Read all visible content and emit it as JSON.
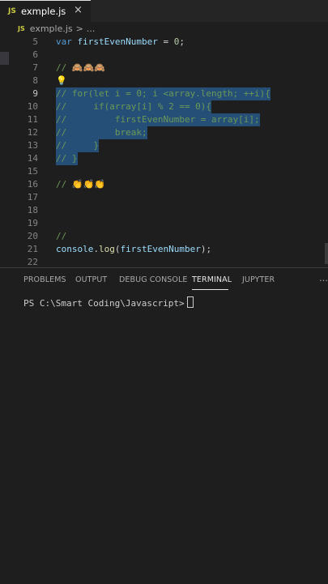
{
  "tab": {
    "filename": "exmple.js",
    "lang_badge": "JS",
    "close": "×"
  },
  "breadcrumb": {
    "lang_badge": "JS",
    "file": "exmple.js",
    "separator": ">",
    "more": "..."
  },
  "editor": {
    "lines": [
      {
        "n": "5",
        "a": "var ",
        "b": "firstEvenNumber",
        "c": " = ",
        "d": "0",
        "e": ";"
      },
      {
        "n": "6"
      },
      {
        "n": "7",
        "comment": "// ",
        "emoji": "🙈🙈🙈"
      },
      {
        "n": "8",
        "bulb": "💡"
      },
      {
        "n": "9",
        "text": "// for(let i = 0; i <array.length; ++i){"
      },
      {
        "n": "10",
        "text": "//     if(array[i] % 2 == 0){"
      },
      {
        "n": "11",
        "text": "//         firstEvenNumber = array[i];"
      },
      {
        "n": "12",
        "text": "//         break;"
      },
      {
        "n": "13",
        "text": "//     }"
      },
      {
        "n": "14",
        "text": "// }"
      },
      {
        "n": "15"
      },
      {
        "n": "16",
        "comment": "// ",
        "emoji": "👏👏👏"
      },
      {
        "n": "17"
      },
      {
        "n": "18"
      },
      {
        "n": "19"
      },
      {
        "n": "20",
        "comment": "//"
      },
      {
        "n": "21",
        "obj": "console",
        "dot": ".",
        "fn": "log",
        "open": "(",
        "arg": "firstEvenNumber",
        "close": ");"
      },
      {
        "n": "22"
      }
    ]
  },
  "panel": {
    "tabs": [
      "PROBLEMS",
      "OUTPUT",
      "DEBUG CONSOLE",
      "TERMINAL",
      "JUPYTER"
    ],
    "active_tab": "TERMINAL",
    "more": "…",
    "prompt": "PS C:\\Smart Coding\\Javascript>"
  },
  "colors": {
    "selection": "#264f78",
    "comment": "#6a9955",
    "keyword": "#569cd6",
    "variable": "#9cdcfe"
  }
}
